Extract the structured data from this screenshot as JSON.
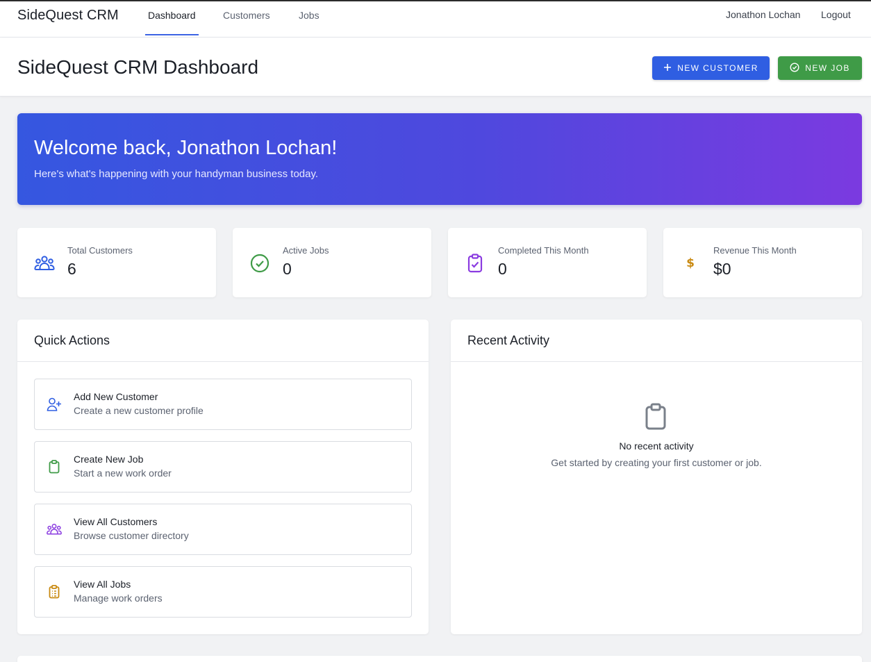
{
  "nav": {
    "brand": "SideQuest CRM",
    "links": [
      "Dashboard",
      "Customers",
      "Jobs"
    ],
    "user": "Jonathon Lochan",
    "logout": "Logout"
  },
  "header": {
    "title": "SideQuest CRM Dashboard",
    "new_customer_label": "NEW CUSTOMER",
    "new_job_label": "NEW JOB"
  },
  "hero": {
    "title": "Welcome back, Jonathon Lochan!",
    "subtitle": "Here's what's happening with your handyman business today."
  },
  "stats": [
    {
      "label": "Total Customers",
      "value": "6",
      "icon": "users-icon",
      "color": "#2f5ee2"
    },
    {
      "label": "Active Jobs",
      "value": "0",
      "icon": "check-circle-icon",
      "color": "#3f9b47"
    },
    {
      "label": "Completed This Month",
      "value": "0",
      "icon": "clipboard-check-icon",
      "color": "#8a3be0"
    },
    {
      "label": "Revenue This Month",
      "value": "$0",
      "icon": "dollar-icon",
      "color": "#c98a12"
    }
  ],
  "quick_actions": {
    "title": "Quick Actions",
    "items": [
      {
        "title": "Add New Customer",
        "subtitle": "Create a new customer profile",
        "icon": "user-plus-icon",
        "color": "#2f5ee2"
      },
      {
        "title": "Create New Job",
        "subtitle": "Start a new work order",
        "icon": "clipboard-icon",
        "color": "#3f9b47"
      },
      {
        "title": "View All Customers",
        "subtitle": "Browse customer directory",
        "icon": "users-icon",
        "color": "#8a3be0"
      },
      {
        "title": "View All Jobs",
        "subtitle": "Manage work orders",
        "icon": "clipboard-list-icon",
        "color": "#c98a12"
      }
    ]
  },
  "recent_activity": {
    "title": "Recent Activity",
    "empty_title": "No recent activity",
    "empty_subtitle": "Get started by creating your first customer or job."
  }
}
